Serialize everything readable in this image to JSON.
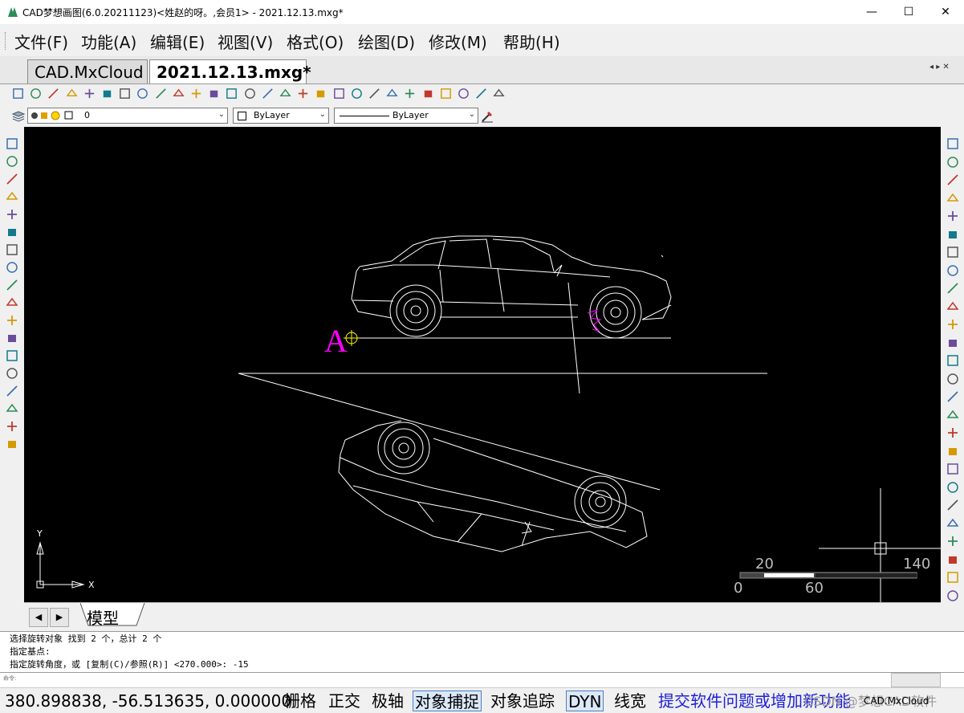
{
  "window": {
    "title": "CAD梦想画图(6.0.20211123)<姓赵的呀。,会员1> - 2021.12.13.mxg*",
    "minimize": "—",
    "maximize": "☐",
    "close": "✕"
  },
  "menu": {
    "items": [
      "文件(F)",
      "功能(A)",
      "编辑(E)",
      "视图(V)",
      "格式(O)",
      "绘图(D)",
      "修改(M)",
      "帮助(H)"
    ]
  },
  "tabs": {
    "items": [
      "CAD.MxCloud",
      "2021.12.13.mxg*"
    ],
    "nav": "◂ ▸ ✕"
  },
  "layerbar": {
    "layer": "0",
    "color": "ByLayer",
    "linetype": "ByLayer"
  },
  "canvas": {
    "label_a": "A",
    "ucs_y": "Y",
    "ucs_x": "X",
    "scale_labels": [
      "20",
      "140",
      "0",
      "60"
    ]
  },
  "model_tab": {
    "label": "模型",
    "prev": "◀",
    "next": "▶"
  },
  "command": {
    "lines": [
      "选择旋转对象  找到 2 个，总计 2 个",
      "指定基点:",
      "指定旋转角度，或 [复制(C)/参照(R)] <270.000>: -15"
    ],
    "prompt": "命令:"
  },
  "status": {
    "coords": "380.898838,  -56.513635,  0.000000",
    "toggles": [
      {
        "label": "栅格",
        "on": false
      },
      {
        "label": "正交",
        "on": false
      },
      {
        "label": "极轴",
        "on": false
      },
      {
        "label": "对象捕捉",
        "on": true
      },
      {
        "label": "对象追踪",
        "on": false
      },
      {
        "label": "DYN",
        "on": true
      },
      {
        "label": "线宽",
        "on": false
      }
    ],
    "feedback_link": "提交软件问题或增加新功能",
    "watermark": "CSDN @梦想CAD软件",
    "brand": "CAD.MxCloud"
  },
  "colors": {
    "canvas_bg": "#000000",
    "drawing_lines": "#ffffff",
    "text_a": "#ff00ff",
    "cursor": "#ffff00",
    "status_on": "#dbe8f7",
    "link": "#1f1fd8"
  },
  "icons": {
    "toolbar1": [
      "new-icon",
      "open-icon",
      "save-icon",
      "save-as-icon",
      "zoom-window-icon",
      "zoom-in-icon",
      "zoom-out-icon",
      "pan-icon",
      "measure-icon",
      "zoom-extents-icon",
      "zoom-realtime-icon",
      "zoom-previous-icon",
      "move-cross-icon",
      "pencil-icon",
      "color-picker-icon",
      "layers-stack-icon",
      "edit-icon",
      "image-icon",
      "grid-icon",
      "brush-icon",
      "print-icon",
      "undo-icon",
      "redo-icon",
      "plot-icon",
      "globe-icon",
      "globe-settings-icon",
      "pdf-icon",
      "export-icon"
    ],
    "left": [
      "line-icon",
      "construction-line-icon",
      "polyline-icon",
      "polygon-icon",
      "rectangle-outline-icon",
      "rectangle-icon",
      "arc-icon",
      "circle-icon",
      "spline-icon",
      "ellipse-icon",
      "ellipse-arc-icon",
      "point-icon",
      "block-insert-icon",
      "block-create-icon",
      "text-icon",
      "hatch-icon",
      "mtext-icon",
      "table-icon"
    ],
    "right": [
      "erase-icon",
      "copy-icon",
      "move-icon",
      "rotate-icon",
      "scale-icon",
      "stretch-icon",
      "array-icon",
      "mirror-icon",
      "offset-icon",
      "fillet-icon",
      "chamfer-icon",
      "trim-icon",
      "extend-icon",
      "explode-icon",
      "break-icon",
      "join-icon",
      "dim-linear-icon",
      "dim-aligned-icon",
      "dim-radius-icon",
      "dim-diameter-icon",
      "dim-angular-icon",
      "dim-continue-icon",
      "bring-front-icon",
      "send-back-icon",
      "draw-order-icon",
      "group-icon"
    ]
  }
}
